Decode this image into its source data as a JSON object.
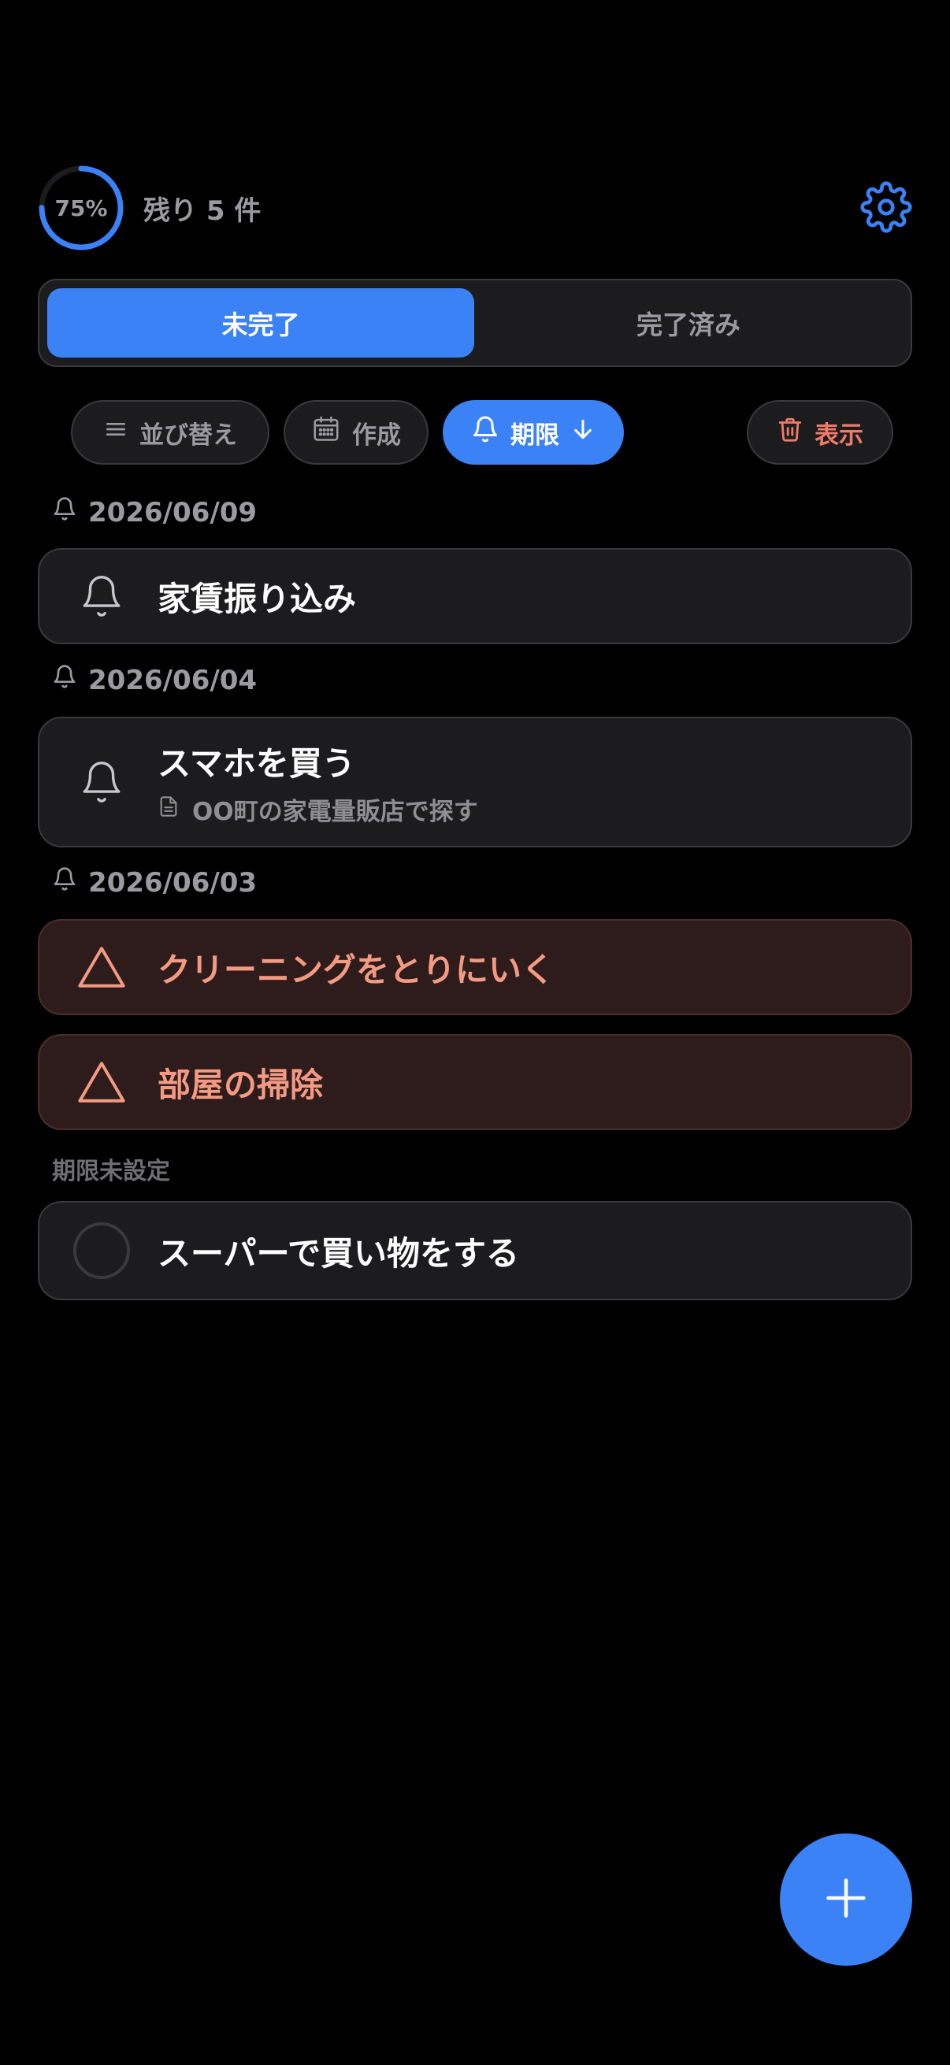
{
  "header": {
    "progress_label": "75%",
    "progress_fraction": 0.75,
    "remaining_text": "残り 5 件"
  },
  "tabs": {
    "incomplete": "未完了",
    "completed": "完了済み"
  },
  "chips": {
    "sort": "並び替え",
    "created": "作成",
    "due": "期限",
    "show_deleted": "表示"
  },
  "sections": [
    {
      "date": "2026/06/09",
      "tasks": [
        {
          "title": "家賃振り込み"
        }
      ]
    },
    {
      "date": "2026/06/04",
      "tasks": [
        {
          "title": "スマホを買う",
          "note": "OO町の家電量販店で探す"
        }
      ]
    },
    {
      "date": "2026/06/03",
      "tasks": [
        {
          "title": "クリーニングをとりにいく"
        },
        {
          "title": "部屋の掃除"
        }
      ]
    },
    {
      "date": "期限未設定",
      "tasks": [
        {
          "title": "スーパーで買い物をする"
        }
      ]
    }
  ],
  "colors": {
    "accent": "#3b82f6",
    "overdue": "#f39a82",
    "danger": "#f07a6a"
  },
  "icons": {
    "settings": "gear-icon",
    "sort": "menu-lines-icon",
    "created": "calendar-icon",
    "due": "bell-icon",
    "due_order": "arrow-down-icon",
    "trash": "trash-icon",
    "overdue": "warning-triangle-icon",
    "note": "document-icon",
    "add": "plus-icon"
  }
}
